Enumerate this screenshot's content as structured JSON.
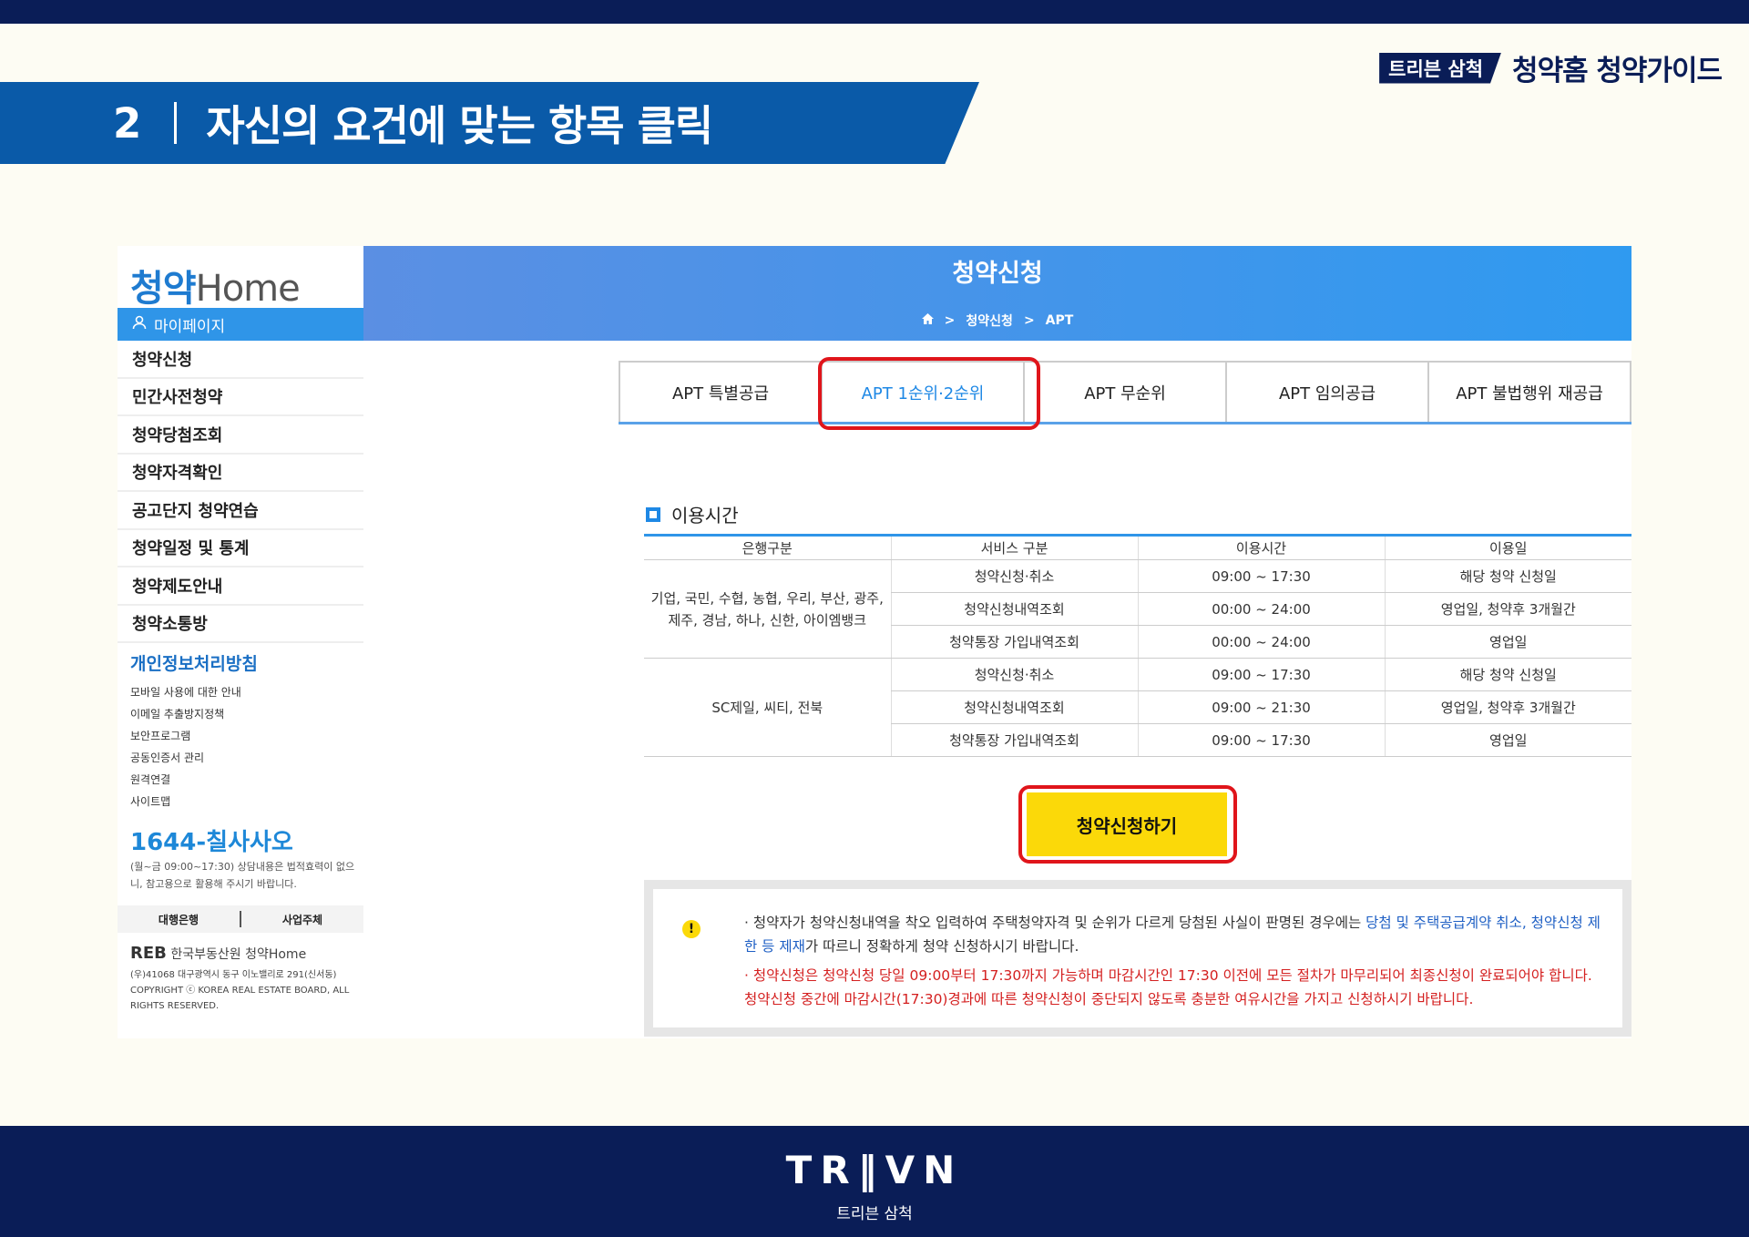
{
  "slide": {
    "brand_tag": "트리븐 삼척",
    "brand_title": "청약홈 청약가이드",
    "step_number": "2",
    "step_heading": "자신의 요건에 맞는 항목 클릭",
    "footer_logo": "TR‖VN",
    "footer_sub": "트리븐 삼척",
    "colors": {
      "navy": "#0a1d57",
      "banner_blue": "#0a5aa8",
      "highlight_red": "#e0151b",
      "button_yellow": "#fbd909"
    }
  },
  "sidebar": {
    "logo_k": "청약",
    "logo_h": "Home",
    "mypage": "마이페이지",
    "menu": [
      "청약신청",
      "민간사전청약",
      "청약당첨조회",
      "청약자격확인",
      "공고단지 청약연습",
      "청약일정 및 통계",
      "청약제도안내",
      "청약소통방"
    ],
    "privacy": "개인정보처리방침",
    "sublinks": [
      "모바일 사용에 대한 안내",
      "이메일 추출방지정책",
      "보안프로그램",
      "공동인증서 관리",
      "원격연결",
      "사이트맵"
    ],
    "phone": "1644-칠사사오",
    "phone_note": "(월~금 09:00~17:30) 상담내용은 법적효력이 없으니, 참고용으로 활용해 주시기 바랍니다.",
    "bank_tabs": [
      "대행은행",
      "사업주체"
    ],
    "footer_org": "한국부동산원",
    "footer_org_logo": "REB",
    "footer_addr": "(우)41068 대구광역시 동구 이노밸리로 291(신서동)",
    "copyright": "COPYRIGHT ⓒ KOREA REAL ESTATE BOARD, ALL RIGHTS RESERVED."
  },
  "header": {
    "title": "청약신청",
    "breadcrumb": [
      "청약신청",
      "APT"
    ]
  },
  "tabs": [
    "APT 특별공급",
    "APT 1순위·2순위",
    "APT 무순위",
    "APT 임의공급",
    "APT 불법행위 재공급"
  ],
  "active_tab": "APT 1순위·2순위",
  "usage": {
    "title": "이용시간",
    "columns": [
      "은행구분",
      "서비스 구분",
      "이용시간",
      "이용일"
    ],
    "groups": [
      {
        "bank": "기업, 국민, 수협, 농협, 우리, 부산, 광주, 제주, 경남, 하나, 신한, 아이엠뱅크",
        "rows": [
          {
            "service": "청약신청·취소",
            "time": "09:00 ~ 17:30",
            "day": "해당 청약 신청일"
          },
          {
            "service": "청약신청내역조회",
            "time": "00:00 ~ 24:00",
            "day": "영업일, 청약후 3개월간"
          },
          {
            "service": "청약통장 가입내역조회",
            "time": "00:00 ~ 24:00",
            "day": "영업일"
          }
        ]
      },
      {
        "bank": "SC제일, 씨티, 전북",
        "rows": [
          {
            "service": "청약신청·취소",
            "time": "09:00 ~ 17:30",
            "day": "해당 청약 신청일"
          },
          {
            "service": "청약신청내역조회",
            "time": "09:00 ~ 21:30",
            "day": "영업일, 청약후 3개월간"
          },
          {
            "service": "청약통장 가입내역조회",
            "time": "09:00 ~ 17:30",
            "day": "영업일"
          }
        ]
      }
    ]
  },
  "apply_button": "청약신청하기",
  "notice": {
    "l1_a": "· 청약자가 청약신청내역을 착오 입력하여 주택청약자격 및 순위가 다르게 당첨된 사실이 판명된 경우에는 ",
    "l1_blue": "당첨 및 주택공급계약 취소, 청약신청 제한 등 제재",
    "l1_b": "가 따르니 정확하게 청약 신청하시기 바랍니다.",
    "l2": "· 청약신청은 청약신청 당일 09:00부터 17:30까지 가능하며 마감시간인 17:30 이전에 모든 절차가 마무리되어 최종신청이 완료되어야 합니다. 청약신청 중간에 마감시간(17:30)경과에 따른 청약신청이 중단되지 않도록 충분한 여유시간을 가지고 신청하시기 바랍니다."
  }
}
